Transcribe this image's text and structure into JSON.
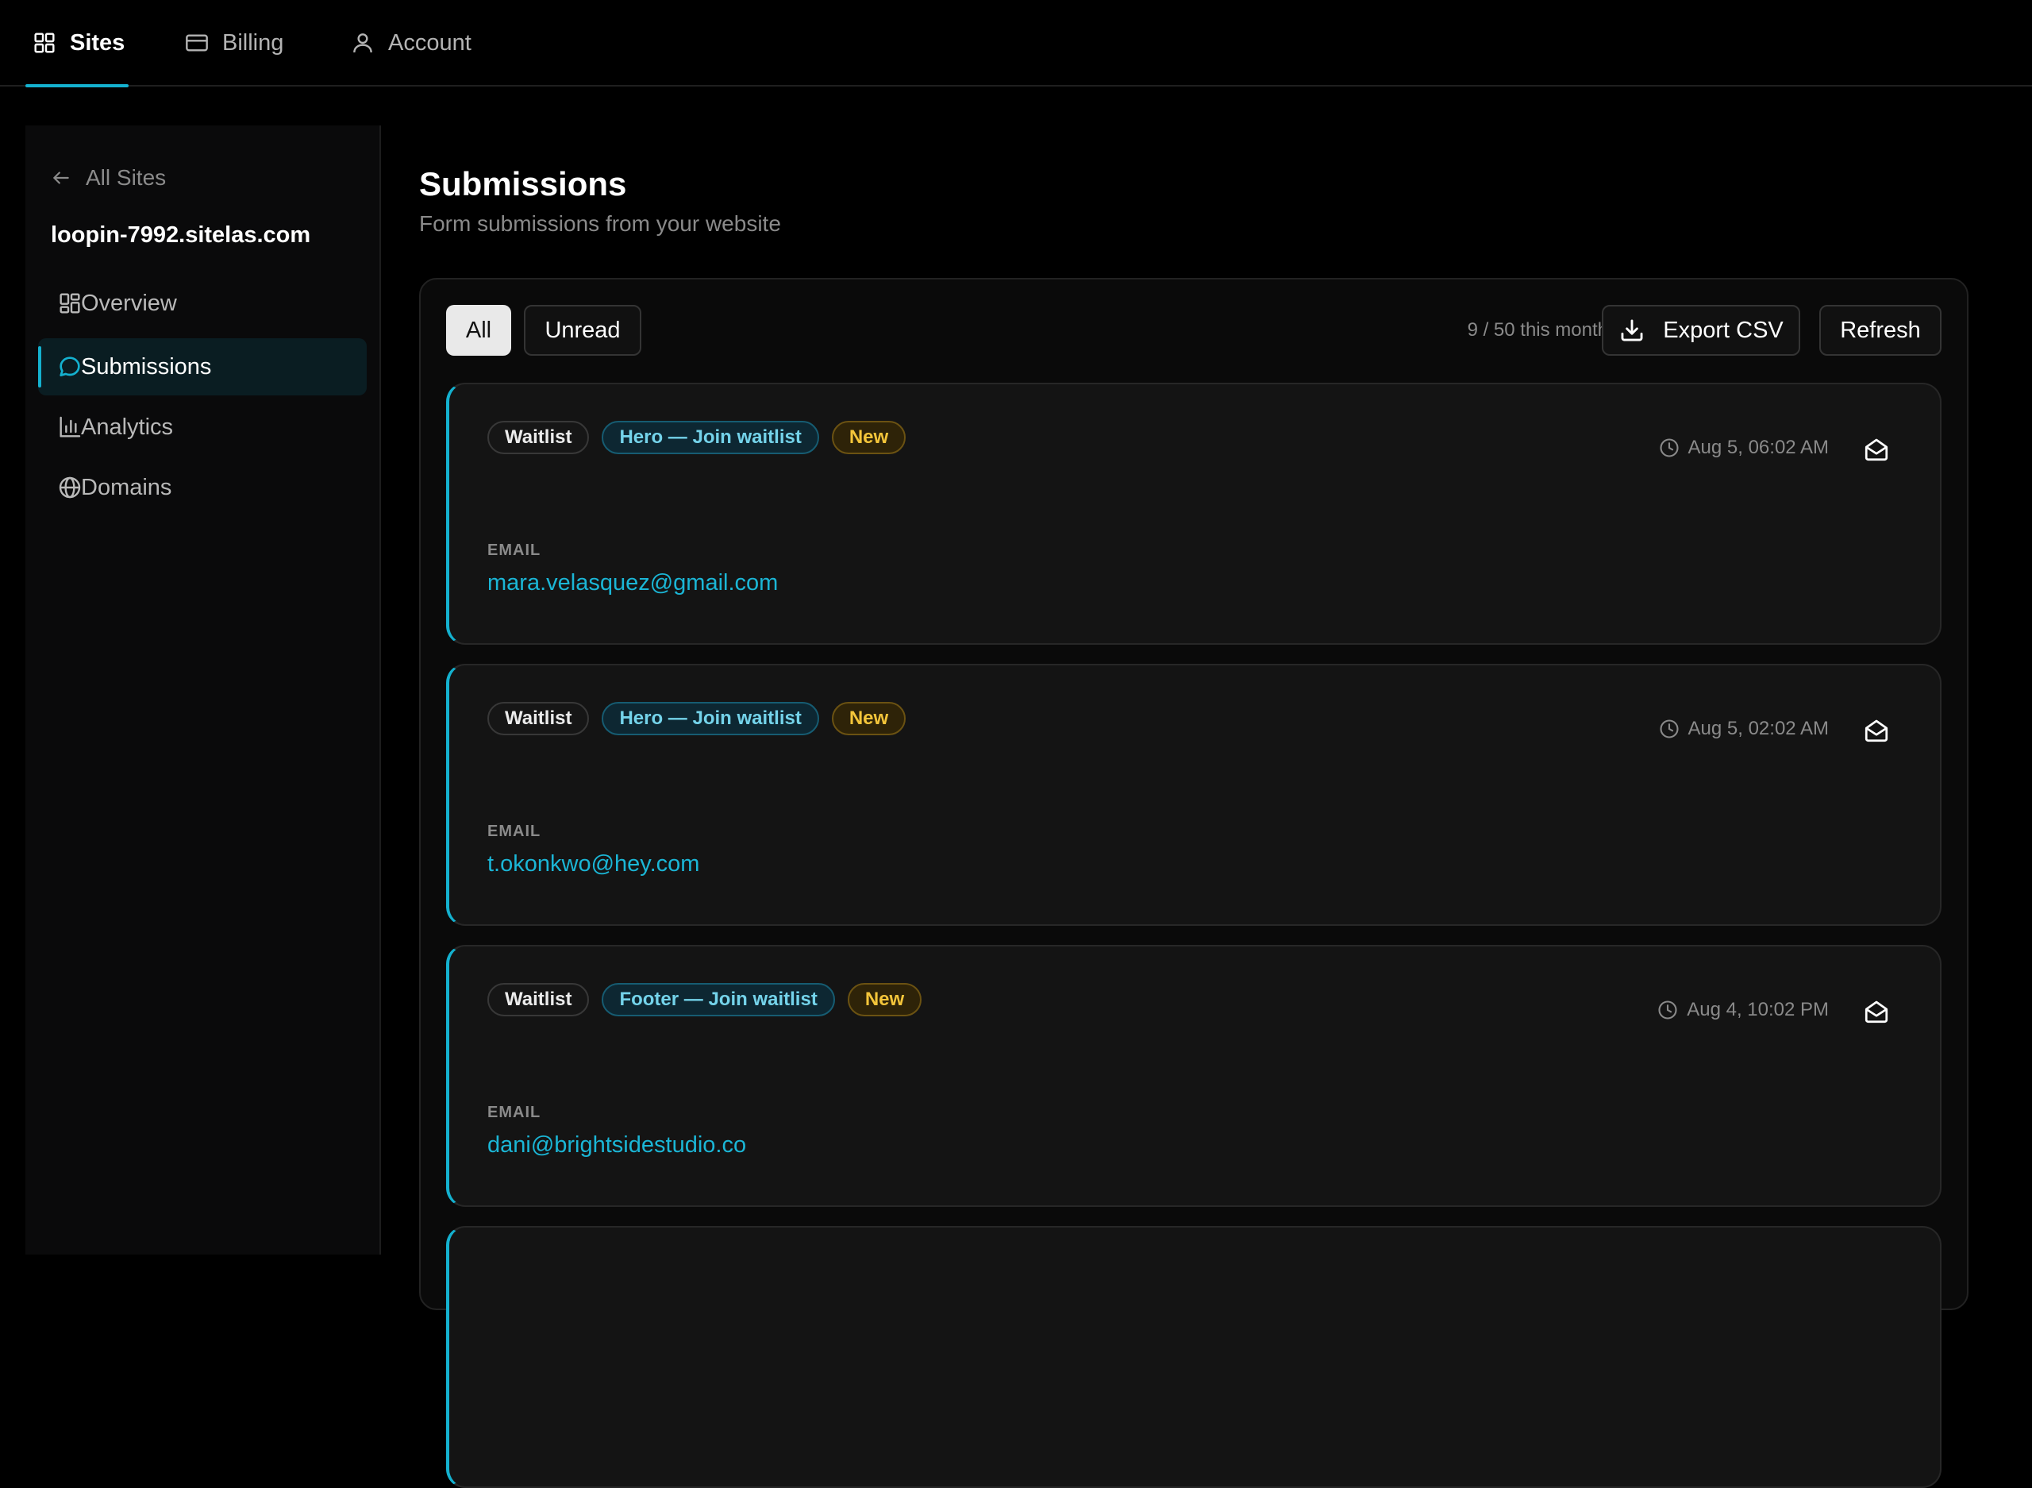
{
  "topnav": {
    "tabs": [
      {
        "label": "Sites",
        "icon": "grid-icon",
        "active": true
      },
      {
        "label": "Billing",
        "icon": "credit-card-icon",
        "active": false
      },
      {
        "label": "Account",
        "icon": "user-icon",
        "active": false
      }
    ]
  },
  "sidebar": {
    "back_label": "All Sites",
    "site_name": "loopin-7992.sitelas.com",
    "items": [
      {
        "label": "Overview",
        "icon": "layout-icon",
        "active": false
      },
      {
        "label": "Submissions",
        "icon": "message-icon",
        "active": true
      },
      {
        "label": "Analytics",
        "icon": "bar-chart-icon",
        "active": false
      },
      {
        "label": "Domains",
        "icon": "globe-icon",
        "active": false
      }
    ]
  },
  "main": {
    "title": "Submissions",
    "subtitle": "Form submissions from your website",
    "filters": {
      "all": "All",
      "unread": "Unread",
      "selected": "All"
    },
    "usage": "9 / 50 this month",
    "export_label": "Export CSV",
    "refresh_label": "Refresh",
    "submissions": [
      {
        "type": "Waitlist",
        "source": "Hero — Join waitlist",
        "status": "New",
        "time": "Aug 5, 06:02 AM",
        "field_label": "EMAIL",
        "field_value": "mara.velasquez@gmail.com"
      },
      {
        "type": "Waitlist",
        "source": "Hero — Join waitlist",
        "status": "New",
        "time": "Aug 5, 02:02 AM",
        "field_label": "EMAIL",
        "field_value": "t.okonkwo@hey.com"
      },
      {
        "type": "Waitlist",
        "source": "Footer — Join waitlist",
        "status": "New",
        "time": "Aug 4, 10:02 PM",
        "field_label": "EMAIL",
        "field_value": "dani@brightsidestudio.co"
      }
    ]
  },
  "colors": {
    "accent": "#14b1cf",
    "status_new": "#f4c53a",
    "link": "#1bb6d6"
  }
}
